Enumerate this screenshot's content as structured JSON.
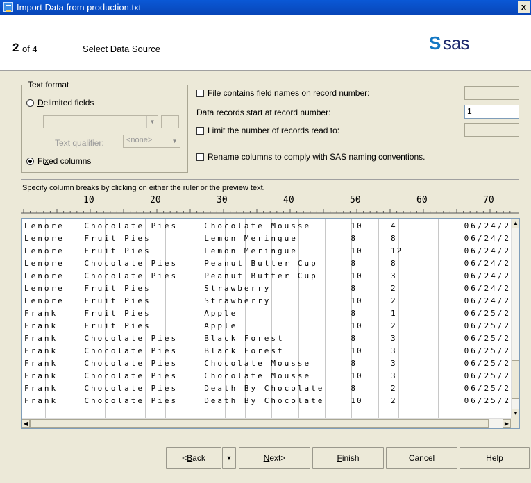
{
  "window": {
    "title": "Import Data from production.txt",
    "close_label": "x"
  },
  "header": {
    "step_number": "2",
    "step_of": "of 4",
    "step_title": "Select Data Source",
    "logo_text": "sas",
    "logo_mark": "S"
  },
  "text_format": {
    "legend": "Text format",
    "delimited_label": "Delimited fields",
    "delimited_accel": "D",
    "qualifier_label": "Text qualifier:",
    "qualifier_value": "<none>",
    "fixed_label": "Fixed columns",
    "fixed_accel": "x",
    "selected": "fixed"
  },
  "options": {
    "field_names_label": "File contains field names on record number:",
    "field_names_checked": false,
    "field_names_value": "",
    "start_label": "Data records start at record number:",
    "start_value": "1",
    "limit_label": "Limit the number of records read to:",
    "limit_checked": false,
    "limit_value": "",
    "rename_label": "Rename columns to comply with SAS naming conventions.",
    "rename_checked": false
  },
  "instructions": "Specify column breaks by clicking on either the ruler or the preview text.",
  "ruler": {
    "labels": [
      "10",
      "20",
      "30",
      "40",
      "50",
      "60",
      "70"
    ]
  },
  "preview": {
    "rows": [
      [
        "Lenore",
        "Chocolate Pies",
        "Chocolate Mousse",
        "10",
        "4",
        "06/24/2"
      ],
      [
        "Lenore",
        "Fruit Pies",
        "Lemon Meringue",
        "8",
        "8",
        "06/24/2"
      ],
      [
        "Lenore",
        "Fruit Pies",
        "Lemon Meringue",
        "10",
        "12",
        "06/24/2"
      ],
      [
        "Lenore",
        "Chocolate Pies",
        "Peanut Butter Cup",
        "8",
        "8",
        "06/24/2"
      ],
      [
        "Lenore",
        "Chocolate Pies",
        "Peanut Butter Cup",
        "10",
        "3",
        "06/24/2"
      ],
      [
        "Lenore",
        "Fruit Pies",
        "Strawberry",
        "8",
        "2",
        "06/24/2"
      ],
      [
        "Lenore",
        "Fruit Pies",
        "Strawberry",
        "10",
        "2",
        "06/24/2"
      ],
      [
        "Frank",
        "Fruit Pies",
        "Apple",
        "8",
        "1",
        "06/25/2"
      ],
      [
        "Frank",
        "Fruit Pies",
        "Apple",
        "10",
        "2",
        "06/25/2"
      ],
      [
        "Frank",
        "Chocolate Pies",
        "Black Forest",
        "8",
        "3",
        "06/25/2"
      ],
      [
        "Frank",
        "Chocolate Pies",
        "Black Forest",
        "10",
        "3",
        "06/25/2"
      ],
      [
        "Frank",
        "Chocolate Pies",
        "Chocolate Mousse",
        "8",
        "3",
        "06/25/2"
      ],
      [
        "Frank",
        "Chocolate Pies",
        "Chocolate Mousse",
        "10",
        "3",
        "06/25/2"
      ],
      [
        "Frank",
        "Chocolate Pies",
        "Death By Chocolate",
        "8",
        "2",
        "06/25/2"
      ],
      [
        "Frank",
        "Chocolate Pies",
        "Death By Chocolate",
        "10",
        "2",
        "06/25/2"
      ]
    ]
  },
  "buttons": {
    "back": "<Back",
    "back_accel": "B",
    "next": "Next>",
    "next_accel": "N",
    "finish": "Finish",
    "finish_accel": "F",
    "cancel": "Cancel",
    "help": "Help"
  },
  "colors": {
    "titlebar": "#0a58d6",
    "logo_blue": "#1377c3",
    "logo_navy": "#1e2a6e"
  },
  "icons": [
    "app-icon",
    "close-icon",
    "sas-logo-icon",
    "dropdown-arrow-icon",
    "scroll-up-icon",
    "scroll-down-icon",
    "scroll-left-icon",
    "scroll-right-icon"
  ]
}
